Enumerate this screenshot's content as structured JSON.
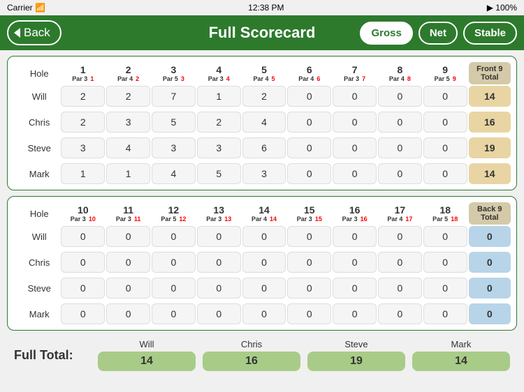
{
  "status": {
    "carrier": "Carrier",
    "wifi_icon": "wifi",
    "time": "12:38 PM",
    "battery": "100%",
    "battery_icon": "battery-full"
  },
  "nav": {
    "back_label": "Back",
    "title": "Full Scorecard",
    "score_types": [
      {
        "id": "gross",
        "label": "Gross",
        "active": true
      },
      {
        "id": "net",
        "label": "Net",
        "active": false
      },
      {
        "id": "stable",
        "label": "Stable",
        "active": false
      }
    ]
  },
  "front9": {
    "section_label": "Front 9",
    "total_label": "Front 9\nTotal",
    "holes": [
      {
        "num": "1",
        "par": "Par 3",
        "si": "S/I 1"
      },
      {
        "num": "2",
        "par": "Par 4",
        "si": "S/I 2"
      },
      {
        "num": "3",
        "par": "Par 5",
        "si": "S/I 3"
      },
      {
        "num": "4",
        "par": "Par 3",
        "si": "S/I 4"
      },
      {
        "num": "5",
        "par": "Par 4",
        "si": "S/I 5"
      },
      {
        "num": "6",
        "par": "Par 4",
        "si": "S/I 6"
      },
      {
        "num": "7",
        "par": "Par 3",
        "si": "S/I 7"
      },
      {
        "num": "8",
        "par": "Par 4",
        "si": "S/I 8"
      },
      {
        "num": "9",
        "par": "Par 5",
        "si": "S/I 9"
      }
    ],
    "holes_par": [
      "3",
      "4",
      "5",
      "3",
      "4",
      "4",
      "3",
      "4",
      "5"
    ],
    "holes_si": [
      "1",
      "2",
      "3",
      "4",
      "5",
      "6",
      "7",
      "8",
      "9"
    ],
    "players": [
      {
        "name": "Will",
        "scores": [
          "2",
          "2",
          "7",
          "1",
          "2",
          "0",
          "0",
          "0",
          "0"
        ],
        "total": "14"
      },
      {
        "name": "Chris",
        "scores": [
          "2",
          "3",
          "5",
          "2",
          "4",
          "0",
          "0",
          "0",
          "0"
        ],
        "total": "16"
      },
      {
        "name": "Steve",
        "scores": [
          "3",
          "4",
          "3",
          "3",
          "6",
          "0",
          "0",
          "0",
          "0"
        ],
        "total": "19"
      },
      {
        "name": "Mark",
        "scores": [
          "1",
          "1",
          "4",
          "5",
          "3",
          "0",
          "0",
          "0",
          "0"
        ],
        "total": "14"
      }
    ]
  },
  "back9": {
    "total_label": "Back 9\nTotal",
    "holes": [
      {
        "num": "10",
        "par": "Par 3",
        "si": "S/I 10"
      },
      {
        "num": "11",
        "par": "Par 3",
        "si": "S/I 11"
      },
      {
        "num": "12",
        "par": "Par 5",
        "si": "S/I 12"
      },
      {
        "num": "13",
        "par": "Par 3",
        "si": "S/I 13"
      },
      {
        "num": "14",
        "par": "Par 4",
        "si": "S/I 14"
      },
      {
        "num": "15",
        "par": "Par 3",
        "si": "S/I 15"
      },
      {
        "num": "16",
        "par": "Par 3",
        "si": "S/I 16"
      },
      {
        "num": "17",
        "par": "Par 4",
        "si": "S/I 17"
      },
      {
        "num": "18",
        "par": "Par 5",
        "si": "S/I 18"
      }
    ],
    "holes_par": [
      "3",
      "3",
      "5",
      "3",
      "4",
      "3",
      "3",
      "4",
      "5"
    ],
    "holes_si": [
      "10",
      "11",
      "12",
      "13",
      "14",
      "15",
      "16",
      "17",
      "18"
    ],
    "players": [
      {
        "name": "Will",
        "scores": [
          "0",
          "0",
          "0",
          "0",
          "0",
          "0",
          "0",
          "0",
          "0"
        ],
        "total": "0"
      },
      {
        "name": "Chris",
        "scores": [
          "0",
          "0",
          "0",
          "0",
          "0",
          "0",
          "0",
          "0",
          "0"
        ],
        "total": "0"
      },
      {
        "name": "Steve",
        "scores": [
          "0",
          "0",
          "0",
          "0",
          "0",
          "0",
          "0",
          "0",
          "0"
        ],
        "total": "0"
      },
      {
        "name": "Mark",
        "scores": [
          "0",
          "0",
          "0",
          "0",
          "0",
          "0",
          "0",
          "0",
          "0"
        ],
        "total": "0"
      }
    ]
  },
  "full_total": {
    "label": "Full Total:",
    "players": [
      {
        "name": "Will",
        "total": "14"
      },
      {
        "name": "Chris",
        "total": "16"
      },
      {
        "name": "Steve",
        "total": "19"
      },
      {
        "name": "Mark",
        "total": "14"
      }
    ]
  }
}
